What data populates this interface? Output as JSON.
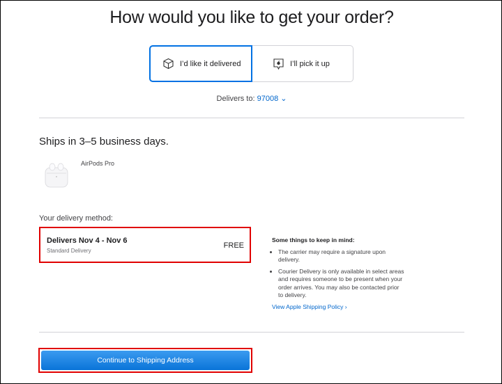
{
  "page": {
    "title": "How would you like to get your order?"
  },
  "fulfillment": {
    "delivered_label": "I’d like it delivered",
    "pickup_label": "I’ll pick it up",
    "selected": "delivered"
  },
  "delivers_to": {
    "prefix": "Delivers to:",
    "zip": "97008",
    "chevron": "⌄"
  },
  "shipping": {
    "ships_text": "Ships in 3–5 business days.",
    "product_name": "AirPods Pro"
  },
  "delivery_method": {
    "label": "Your delivery method:",
    "dates": "Delivers Nov 4 - Nov 6",
    "type": "Standard Delivery",
    "price": "FREE"
  },
  "notes": {
    "heading": "Some things to keep in mind:",
    "items": [
      "The carrier may require a signature upon delivery.",
      "Courier Delivery is only available in select areas and requires someone to be present when your order arrives. You may also be contacted prior to delivery."
    ],
    "policy_link": "View Apple Shipping Policy ›"
  },
  "cta": {
    "label": "Continue to Shipping Address"
  },
  "colors": {
    "accent": "#0071e3",
    "link": "#0066cc",
    "highlight": "#e00000",
    "button_top": "#3b9bf0",
    "button_bottom": "#0a74d8"
  }
}
